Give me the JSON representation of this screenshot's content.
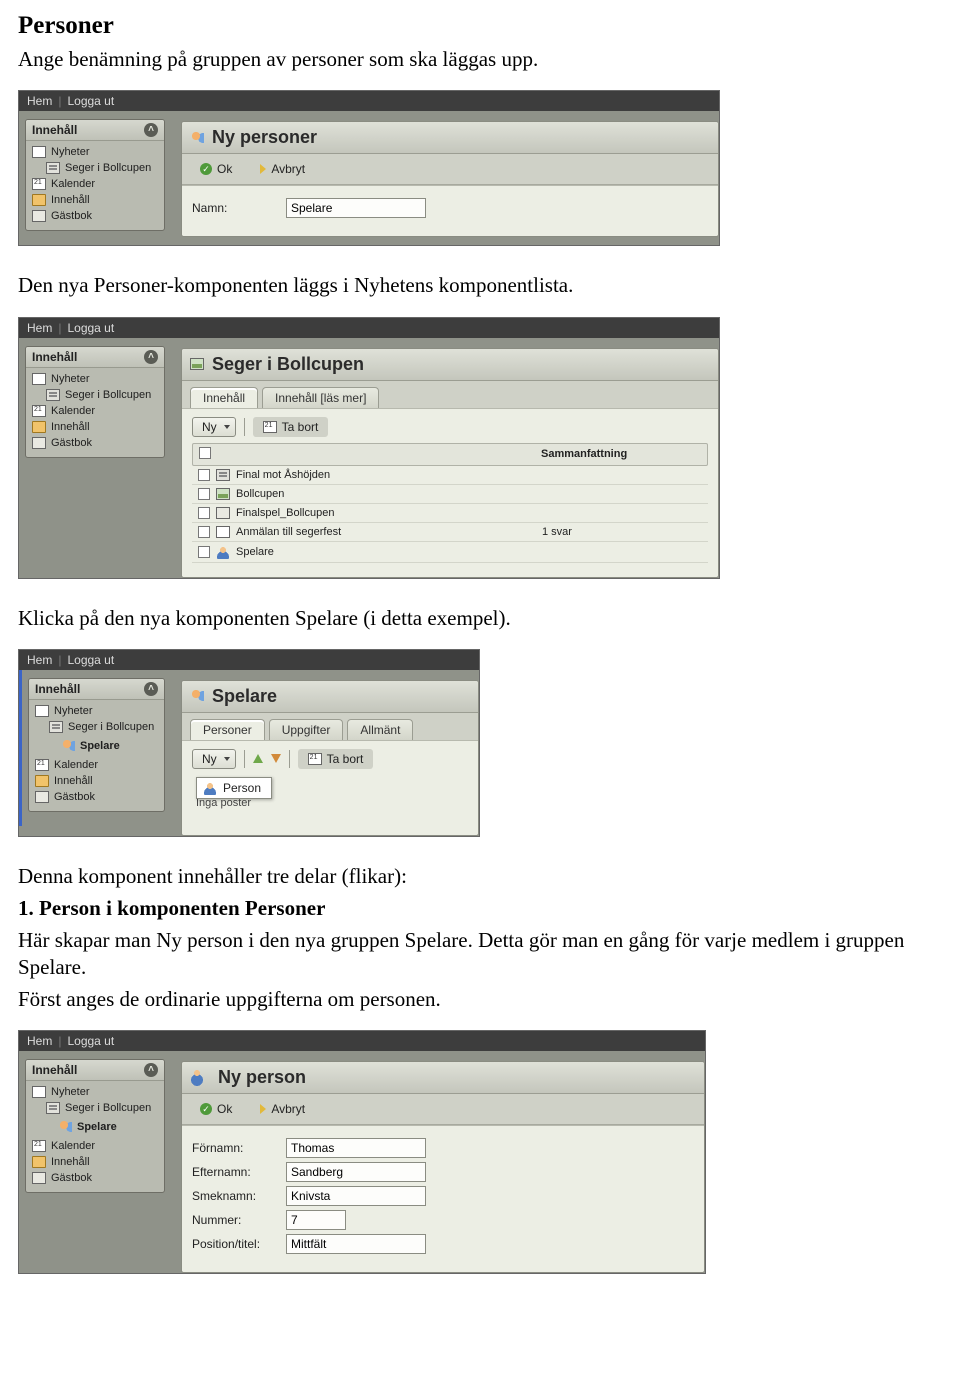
{
  "doc": {
    "heading": "Personer",
    "p1": "Ange benämning på gruppen av personer som ska läggas upp.",
    "p2": "Den nya Personer-komponenten läggs i Nyhetens komponentlista.",
    "p3": "Klicka på den nya komponenten Spelare (i detta exempel).",
    "p4": "Denna komponent innehåller tre delar (flikar):",
    "p5_title": "1. Person i komponenten Personer",
    "p5a": "Här skapar man Ny person i den nya gruppen Spelare. Detta gör man en gång för varje medlem i gruppen Spelare.",
    "p5b": "Först anges de ordinarie uppgifterna om personen."
  },
  "common": {
    "topbar": {
      "home": "Hem",
      "logout": "Logga ut"
    },
    "sidebar_title": "Innehåll"
  },
  "shot1": {
    "sidebar": [
      {
        "label": "Nyheter",
        "icon": "page"
      },
      {
        "label": "Seger i Bollcupen",
        "icon": "doc",
        "indent": true
      },
      {
        "label": "Kalender",
        "icon": "cal"
      },
      {
        "label": "Innehåll",
        "icon": "fold"
      },
      {
        "label": "Gästbok",
        "icon": "note"
      }
    ],
    "panel_title": "Ny personer",
    "ok": "Ok",
    "cancel": "Avbryt",
    "name_label": "Namn:",
    "name_value": "Spelare"
  },
  "shot2": {
    "sidebar": [
      {
        "label": "Nyheter",
        "icon": "page"
      },
      {
        "label": "Seger i Bollcupen",
        "icon": "doc",
        "indent": true
      },
      {
        "label": "Kalender",
        "icon": "cal"
      },
      {
        "label": "Innehåll",
        "icon": "fold"
      },
      {
        "label": "Gästbok",
        "icon": "note"
      }
    ],
    "panel_title": "Seger i Bollcupen",
    "tabs": [
      "Innehåll",
      "Innehåll [läs mer]"
    ],
    "ny": "Ny",
    "tabort": "Ta bort",
    "col_summary": "Sammanfattning",
    "rows": [
      {
        "name": "Final mot Åshöjden",
        "icon": "doc"
      },
      {
        "name": "Bollcupen",
        "icon": "img"
      },
      {
        "name": "Finalspel_Bollcupen",
        "icon": "att"
      },
      {
        "name": "Anmälan till segerfest",
        "icon": "form",
        "summary": "1 svar"
      },
      {
        "name": "Spelare",
        "icon": "people"
      }
    ]
  },
  "shot3": {
    "sidebar": [
      {
        "label": "Nyheter",
        "icon": "page"
      },
      {
        "label": "Seger i Bollcupen",
        "icon": "doc",
        "indent": true
      },
      {
        "label": "Spelare",
        "icon": "people",
        "indent": true,
        "indent2": true,
        "sel": true
      },
      {
        "label": "Kalender",
        "icon": "cal"
      },
      {
        "label": "Innehåll",
        "icon": "fold"
      },
      {
        "label": "Gästbok",
        "icon": "note"
      }
    ],
    "panel_title": "Spelare",
    "tabs": [
      "Personer",
      "Uppgifter",
      "Allmänt"
    ],
    "ny": "Ny",
    "tabort": "Ta bort",
    "popup": "Person",
    "noresults": "Inga poster"
  },
  "shot4": {
    "sidebar": [
      {
        "label": "Nyheter",
        "icon": "page"
      },
      {
        "label": "Seger i Bollcupen",
        "icon": "doc",
        "indent": true
      },
      {
        "label": "Spelare",
        "icon": "people",
        "indent": true,
        "indent2": true,
        "sel": true
      },
      {
        "label": "Kalender",
        "icon": "cal"
      },
      {
        "label": "Innehåll",
        "icon": "fold"
      },
      {
        "label": "Gästbok",
        "icon": "note"
      }
    ],
    "panel_title": "Ny person",
    "ok": "Ok",
    "cancel": "Avbryt",
    "fields": {
      "fornamn": {
        "label": "Förnamn:",
        "value": "Thomas"
      },
      "efternamn": {
        "label": "Efternamn:",
        "value": "Sandberg"
      },
      "smeknamn": {
        "label": "Smeknamn:",
        "value": "Knivsta"
      },
      "nummer": {
        "label": "Nummer:",
        "value": "7"
      },
      "position": {
        "label": "Position/titel:",
        "value": "Mittfält"
      }
    }
  }
}
